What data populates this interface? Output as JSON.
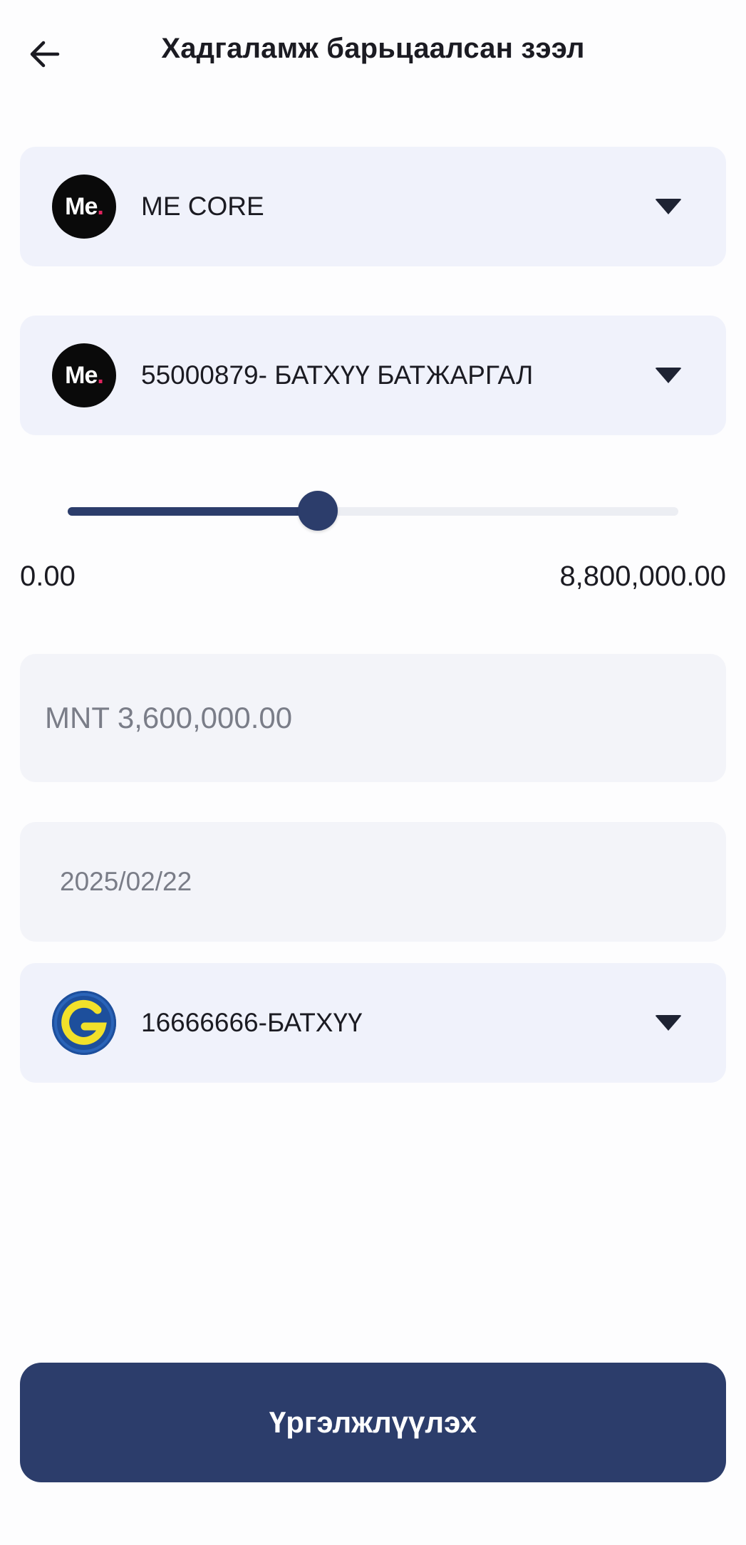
{
  "header": {
    "title": "Хадгаламж барьцаалсан зээл",
    "back_icon": "arrow-left-icon"
  },
  "provider_select": {
    "logo_text": "Me",
    "logo_dot": ".",
    "label": "ME CORE",
    "icon": "caret-down-icon"
  },
  "account_select": {
    "logo_text": "Me",
    "logo_dot": ".",
    "label": "55000879- БАТХҮҮ БАТЖАРГАЛ",
    "icon": "caret-down-icon"
  },
  "slider": {
    "min_label": "0.00",
    "max_label": "8,800,000.00",
    "min": 0,
    "max": 8800000,
    "value_fraction": 0.41
  },
  "amount_field": {
    "value": "MNT 3,600,000.00"
  },
  "date_field": {
    "value": "2025/02/22"
  },
  "receiver_select": {
    "label": "16666666-БАТХҮҮ",
    "logo_icon": "g-logo-icon",
    "icon": "caret-down-icon"
  },
  "continue_button": {
    "label": "Үргэлжлүүлэх"
  },
  "colors": {
    "primary": "#2c3d6b",
    "card_bg": "#f0f2fb",
    "input_bg": "#f3f4f9"
  }
}
